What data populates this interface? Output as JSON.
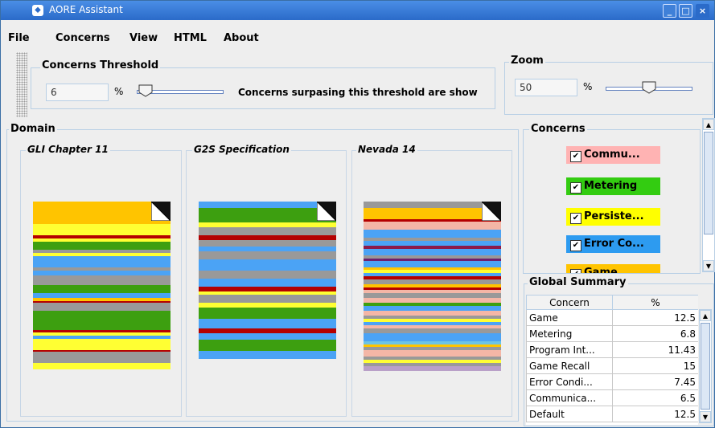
{
  "window": {
    "title": "AORE Assistant",
    "minimize_label": "_",
    "maximize_label": "□",
    "close_label": "×"
  },
  "menu": [
    "File",
    "Concerns",
    "View",
    "HTML",
    "About"
  ],
  "threshold": {
    "legend": "Concerns Threshold",
    "value": "6",
    "unit": "%",
    "note": "Concerns surpasing this threshold are show",
    "slider_value_percent": 6
  },
  "zoom": {
    "legend": "Zoom",
    "value": "50",
    "unit": "%",
    "slider_value_percent": 50
  },
  "domain": {
    "legend": "Domain",
    "documents": [
      {
        "title": "GLI Chapter 11",
        "stripes": [
          [
            "#ffc400",
            28
          ],
          [
            "#ffff33",
            14
          ],
          [
            "#b40000",
            4
          ],
          [
            "#ffff33",
            4
          ],
          [
            "#3d9f10",
            10
          ],
          [
            "#999999",
            4
          ],
          [
            "#ffff33",
            4
          ],
          [
            "#4ba3f5",
            14
          ],
          [
            "#999999",
            4
          ],
          [
            "#4ba3f5",
            6
          ],
          [
            "#999999",
            12
          ],
          [
            "#3d9f10",
            10
          ],
          [
            "#4ba3f5",
            6
          ],
          [
            "#ffc400",
            4
          ],
          [
            "#b40000",
            2
          ],
          [
            "#999999",
            10
          ],
          [
            "#3d9f10",
            24
          ],
          [
            "#b40000",
            3
          ],
          [
            "#ffff33",
            4
          ],
          [
            "#4ba3f5",
            4
          ],
          [
            "#ffff33",
            14
          ],
          [
            "#b40000",
            2
          ],
          [
            "#999999",
            14
          ],
          [
            "#ffff33",
            8
          ]
        ]
      },
      {
        "title": "G2S Specification",
        "stripes": [
          [
            "#4ba3f5",
            8
          ],
          [
            "#3d9f10",
            18
          ],
          [
            "#ffff33",
            6
          ],
          [
            "#999999",
            10
          ],
          [
            "#b40000",
            6
          ],
          [
            "#999999",
            8
          ],
          [
            "#4ba3f5",
            6
          ],
          [
            "#999999",
            10
          ],
          [
            "#4ba3f5",
            14
          ],
          [
            "#999999",
            10
          ],
          [
            "#4ba3f5",
            10
          ],
          [
            "#b40000",
            6
          ],
          [
            "#ffff33",
            4
          ],
          [
            "#999999",
            10
          ],
          [
            "#ffff33",
            6
          ],
          [
            "#3d9f10",
            14
          ],
          [
            "#4ba3f5",
            12
          ],
          [
            "#b40000",
            6
          ],
          [
            "#4ba3f5",
            8
          ],
          [
            "#3d9f10",
            14
          ],
          [
            "#4ba3f5",
            10
          ]
        ]
      },
      {
        "title": "Nevada 14",
        "stripes": [
          [
            "#999999",
            8
          ],
          [
            "#ffc400",
            14
          ],
          [
            "#b40000",
            3
          ],
          [
            "#f4b6a6",
            10
          ],
          [
            "#4ba3f5",
            10
          ],
          [
            "#999999",
            4
          ],
          [
            "#4ba3f5",
            6
          ],
          [
            "#8b1a4a",
            4
          ],
          [
            "#4ba3f5",
            8
          ],
          [
            "#999999",
            4
          ],
          [
            "#6e1f6e",
            3
          ],
          [
            "#4ba3f5",
            8
          ],
          [
            "#ffc400",
            3
          ],
          [
            "#ffff33",
            4
          ],
          [
            "#4ba3f5",
            4
          ],
          [
            "#b40000",
            4
          ],
          [
            "#999999",
            6
          ],
          [
            "#ffc400",
            4
          ],
          [
            "#b40000",
            3
          ],
          [
            "#f4b6a6",
            4
          ],
          [
            "#999999",
            6
          ],
          [
            "#f4b6a6",
            6
          ],
          [
            "#3d9f10",
            4
          ],
          [
            "#4ba3f5",
            6
          ],
          [
            "#f4b6a6",
            6
          ],
          [
            "#999999",
            4
          ],
          [
            "#ffff33",
            4
          ],
          [
            "#4ba3f5",
            4
          ],
          [
            "#f4b6a6",
            4
          ],
          [
            "#999999",
            6
          ],
          [
            "#4ba3f5",
            10
          ],
          [
            "#6cc3e6",
            4
          ],
          [
            "#ffc400",
            3
          ],
          [
            "#999999",
            4
          ],
          [
            "#f4b6a6",
            8
          ],
          [
            "#999999",
            4
          ],
          [
            "#ffff33",
            4
          ],
          [
            "#999999",
            4
          ],
          [
            "#b9a0c8",
            6
          ]
        ]
      }
    ]
  },
  "concerns": {
    "legend": "Concerns",
    "items": [
      {
        "label": "Commu...",
        "color": "#ffb3b3",
        "checked": "✔"
      },
      {
        "label": "Metering",
        "color": "#33cc11",
        "checked": "✔"
      },
      {
        "label": "Persiste...",
        "color": "#ffff00",
        "checked": "✔"
      },
      {
        "label": "Error Co...",
        "color": "#2d9bf0",
        "checked": "✔"
      },
      {
        "label": "Game",
        "color": "#ffc400",
        "checked": "✔"
      }
    ]
  },
  "summary": {
    "legend": "Global Summary",
    "columns": [
      "Concern",
      "%"
    ],
    "rows": [
      [
        "Game",
        "12.5"
      ],
      [
        "Metering",
        "6.8"
      ],
      [
        "Program Int...",
        "11.43"
      ],
      [
        "Game Recall",
        "15"
      ],
      [
        "Error Condi...",
        "7.45"
      ],
      [
        "Communica...",
        "6.5"
      ],
      [
        "Default",
        "12.5"
      ]
    ]
  }
}
